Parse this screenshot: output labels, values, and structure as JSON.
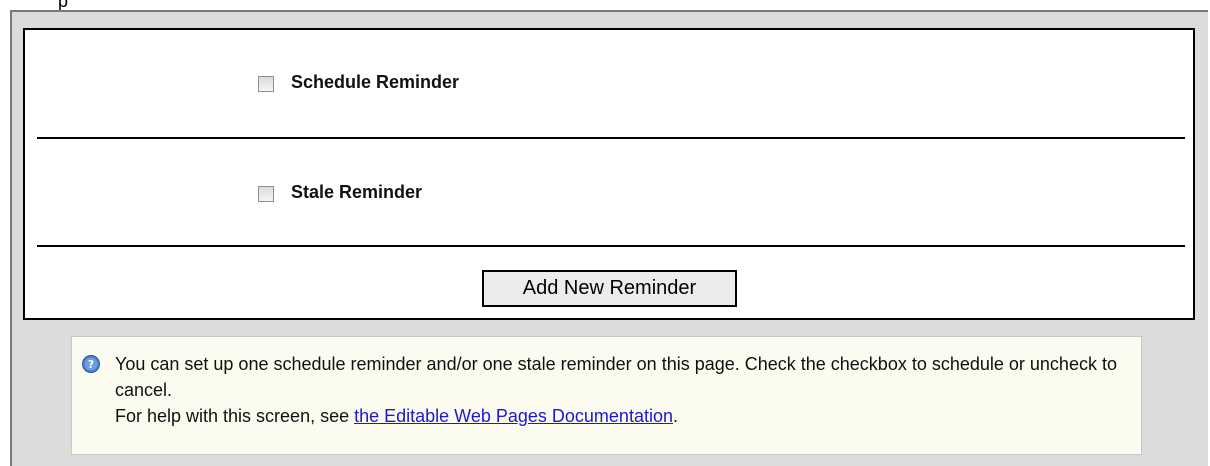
{
  "page": {
    "top_fragment": "p"
  },
  "reminders": {
    "items": [
      {
        "label": "Schedule Reminder",
        "checked": false
      },
      {
        "label": "Stale Reminder",
        "checked": false
      }
    ],
    "add_button_label": "Add New Reminder"
  },
  "info": {
    "icon": "help-icon",
    "message": "You can set up one schedule reminder and/or one stale reminder on this page. Check the checkbox to schedule or uncheck to cancel.",
    "help_prefix": "For help with this screen, see ",
    "help_link_text": "the Editable Web Pages Documentation",
    "help_suffix": "."
  },
  "colors": {
    "link": "#1a1ad6",
    "page_background": "#dcdcdc",
    "info_background": "#fbfbf0"
  }
}
